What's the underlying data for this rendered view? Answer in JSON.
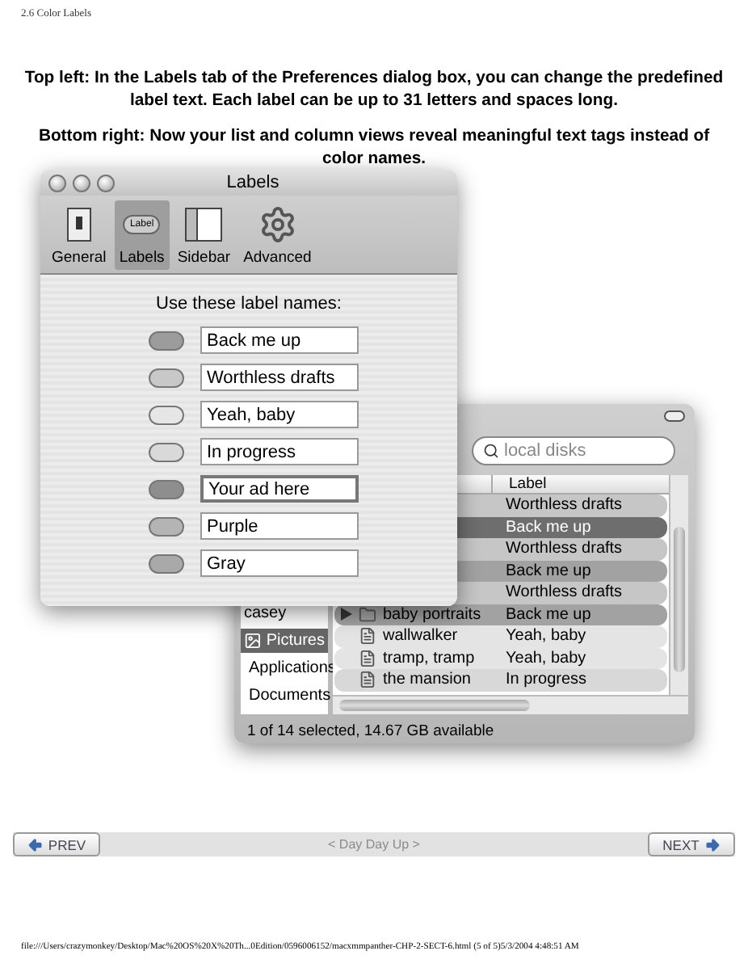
{
  "page_header": "2.6 Color Labels",
  "captions": [
    "Top left: In the Labels tab of the Preferences dialog box, you can change the predefined label text. Each label can be up to 31 letters and spaces long.",
    "Bottom right: Now your list and column views reveal meaningful text tags instead of color names."
  ],
  "finder_window": {
    "search": {
      "placeholder": "local disks"
    },
    "column_header": "Label",
    "sidebar": [
      {
        "label": "casey",
        "selected": false
      },
      {
        "label": "Pictures",
        "selected": true
      },
      {
        "label": "Applications",
        "selected": false
      },
      {
        "label": "Documents",
        "selected": false
      }
    ],
    "rows": [
      {
        "label": "Worthless drafts",
        "color": "#c6c6c6",
        "selected": false
      },
      {
        "label": "Back me up",
        "color": "#6e6e6e",
        "selected": true
      },
      {
        "label": "Worthless drafts",
        "color": "#c6c6c6",
        "selected": false
      },
      {
        "label": "Back me up",
        "color": "#a2a2a2",
        "selected": false
      },
      {
        "label": "Worthless drafts",
        "color": "#c6c6c6",
        "selected": false
      },
      {
        "name": "baby portraits",
        "kind": "folder",
        "label": "Back me up",
        "color": "#a2a2a2",
        "selected": false
      },
      {
        "name": "wallwalker",
        "kind": "file",
        "label": "Yeah, baby",
        "color": "#e4e4e4",
        "selected": false
      },
      {
        "name": "tramp, tramp",
        "kind": "file",
        "label": "Yeah, baby",
        "color": "#e4e4e4",
        "selected": false
      },
      {
        "name": "the mansion",
        "kind": "file",
        "label": "In progress",
        "color": "#d8d8d8",
        "selected": false
      }
    ],
    "status": "1 of 14 selected, 14.67 GB available"
  },
  "prefs_window": {
    "title": "Labels",
    "tabs": [
      {
        "label": "General",
        "kind": "general",
        "selected": false
      },
      {
        "label": "Labels",
        "kind": "labels",
        "badge": "Label",
        "selected": true
      },
      {
        "label": "Sidebar",
        "kind": "sidebar",
        "selected": false
      },
      {
        "label": "Advanced",
        "kind": "advanced",
        "selected": false
      }
    ],
    "heading": "Use these label names:",
    "labels": [
      {
        "value": "Back me up",
        "color": "#9c9c9c",
        "focused": false
      },
      {
        "value": "Worthless drafts",
        "color": "#c8c8c8",
        "focused": false
      },
      {
        "value": "Yeah, baby",
        "color": "#e6e6e6",
        "focused": false
      },
      {
        "value": "In progress",
        "color": "#d9d9d9",
        "focused": false
      },
      {
        "value": "Your ad here",
        "color": "#8e8e8e",
        "focused": true
      },
      {
        "value": "Purple",
        "color": "#b4b4b4",
        "focused": false
      },
      {
        "value": "Gray",
        "color": "#a9a9a9",
        "focused": false
      }
    ]
  },
  "nav": {
    "prev": "PREV",
    "center": "< Day Day Up >",
    "next": "NEXT"
  },
  "footer": "file:///Users/crazymonkey/Desktop/Mac%20OS%20X%20Th...0Edition/0596006152/macxmmpanther-CHP-2-SECT-6.html (5 of 5)5/3/2004 4:48:51 AM"
}
